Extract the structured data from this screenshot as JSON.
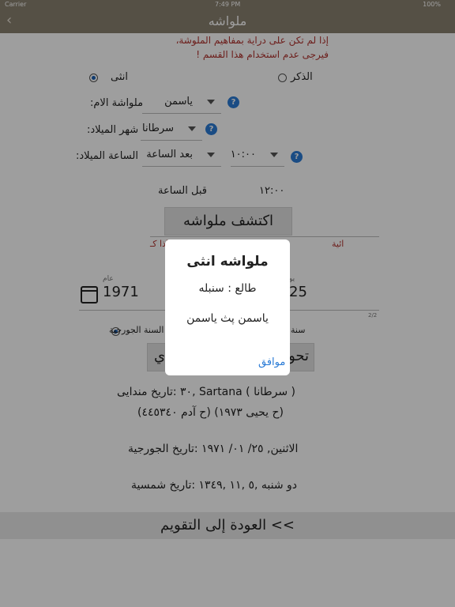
{
  "status": {
    "carrier": "Carrier",
    "time": "7:49 PM",
    "battery": "100%"
  },
  "nav": {
    "title": "ملواشه",
    "back": "‹"
  },
  "warning": {
    "line1": "إذا لم تكن على دراية بمفاهيم الملوشة،",
    "line2": "فيرجى عدم استخدام هذا القسم !"
  },
  "gender": {
    "male": "الذكر",
    "female": "انثى",
    "selected": "female"
  },
  "mother": {
    "label": "ملواشة الام:",
    "value": "ياسمن"
  },
  "birth_month": {
    "label": "شهر الميلاد:",
    "value": "سرطانا"
  },
  "birth_hour": {
    "label": "الساعة الميلاد:",
    "period": "بعد الساعة",
    "time": "١٠:٠٠"
  },
  "before_hour": {
    "label": "قبل الساعة",
    "time": "١٢:٠٠"
  },
  "discover_button": "اكتشف ملواشه",
  "hidden_warning": "إذا كـ",
  "hidden_warning_end": "ائية",
  "date": {
    "year_label": "عام",
    "year": "1971",
    "day_partial": "25",
    "day_label_partial": "يو",
    "page": "2/2"
  },
  "calendar_choice": {
    "gregorian": "السنة الجورجية",
    "other_partial": "سنة",
    "selected": "gregorian"
  },
  "convert_button_left": "تحو",
  "convert_button_right": "ي",
  "info": {
    "mandaean_1": "( سرطانا ) Sartana  ,٣٠  :تاريخ مندايى",
    "mandaean_2": "(ح يحيى ١٩٧٣) (ح آدم ٤٤٥٣٤٠)",
    "gregorian": "الاثنين, ٢٥/ ٠١/ ١٩٧١  :تاريخ الجورجية",
    "solar": "دو شنبه ,٥ ,١١ ,١٣٤٩  :تاريخ شمسية"
  },
  "back_to_calendar": "العودة إلى التقويم <<",
  "dialog": {
    "title": "ملواشه انثى",
    "line1": "طالع : سنبله",
    "line2": "ياسمن  پث ياسمن",
    "ok": "موافق"
  },
  "colors": {
    "nav": "#8a8170",
    "warning": "#b0322e",
    "accent": "#2a7bd6"
  }
}
